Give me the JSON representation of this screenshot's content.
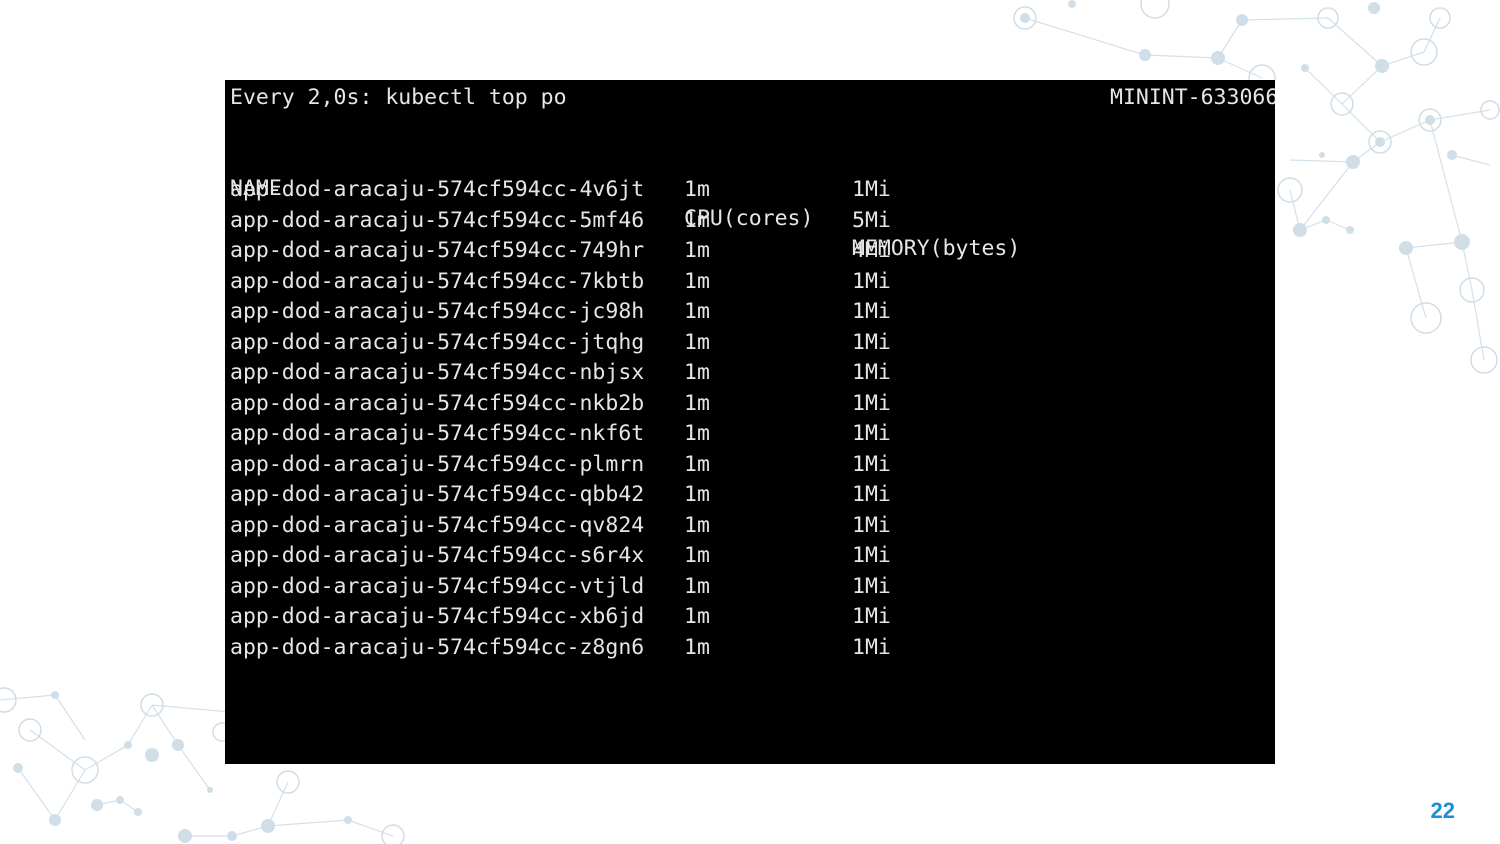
{
  "terminal": {
    "command_line": "Every 2,0s: kubectl top po",
    "host": "MININT-633066",
    "columns": [
      "NAME",
      "CPU(cores)",
      "MEMORY(bytes)"
    ],
    "pods": [
      {
        "name": "app-dod-aracaju-574cf594cc-4v6jt",
        "cpu": "1m",
        "memory": "1Mi"
      },
      {
        "name": "app-dod-aracaju-574cf594cc-5mf46",
        "cpu": "1m",
        "memory": "5Mi"
      },
      {
        "name": "app-dod-aracaju-574cf594cc-749hr",
        "cpu": "1m",
        "memory": "4Mi"
      },
      {
        "name": "app-dod-aracaju-574cf594cc-7kbtb",
        "cpu": "1m",
        "memory": "1Mi"
      },
      {
        "name": "app-dod-aracaju-574cf594cc-jc98h",
        "cpu": "1m",
        "memory": "1Mi"
      },
      {
        "name": "app-dod-aracaju-574cf594cc-jtqhg",
        "cpu": "1m",
        "memory": "1Mi"
      },
      {
        "name": "app-dod-aracaju-574cf594cc-nbjsx",
        "cpu": "1m",
        "memory": "1Mi"
      },
      {
        "name": "app-dod-aracaju-574cf594cc-nkb2b",
        "cpu": "1m",
        "memory": "1Mi"
      },
      {
        "name": "app-dod-aracaju-574cf594cc-nkf6t",
        "cpu": "1m",
        "memory": "1Mi"
      },
      {
        "name": "app-dod-aracaju-574cf594cc-plmrn",
        "cpu": "1m",
        "memory": "1Mi"
      },
      {
        "name": "app-dod-aracaju-574cf594cc-qbb42",
        "cpu": "1m",
        "memory": "1Mi"
      },
      {
        "name": "app-dod-aracaju-574cf594cc-qv824",
        "cpu": "1m",
        "memory": "1Mi"
      },
      {
        "name": "app-dod-aracaju-574cf594cc-s6r4x",
        "cpu": "1m",
        "memory": "1Mi"
      },
      {
        "name": "app-dod-aracaju-574cf594cc-vtjld",
        "cpu": "1m",
        "memory": "1Mi"
      },
      {
        "name": "app-dod-aracaju-574cf594cc-xb6jd",
        "cpu": "1m",
        "memory": "1Mi"
      },
      {
        "name": "app-dod-aracaju-574cf594cc-z8gn6",
        "cpu": "1m",
        "memory": "1Mi"
      }
    ]
  },
  "slide": {
    "page_number": "22"
  },
  "colors": {
    "terminal_bg": "#000000",
    "terminal_text": "#e6e6e6",
    "page_number": "#1a8fd4",
    "network_line": "#c9dbe6",
    "network_node": "#cfdde6"
  }
}
